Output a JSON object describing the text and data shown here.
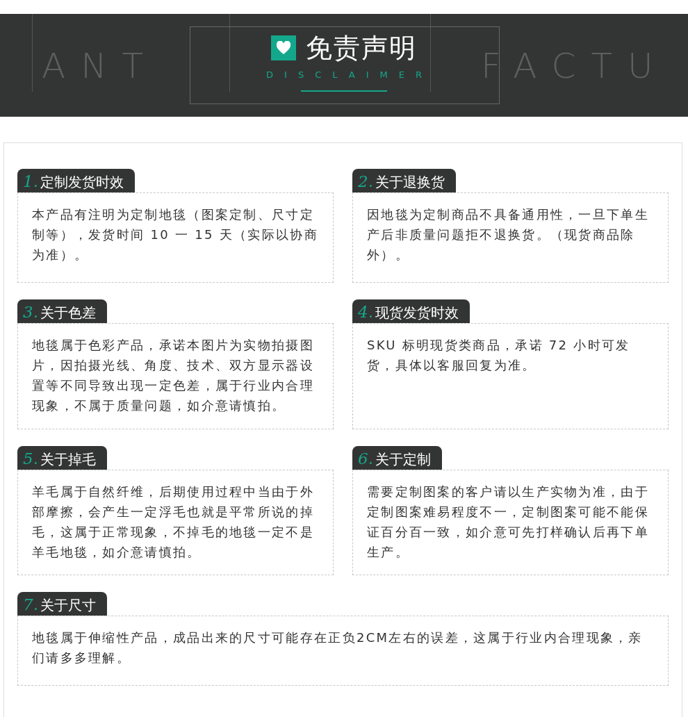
{
  "banner": {
    "title": "免责声明",
    "subtitle": "DISCLAIMER",
    "background_lettering_left": "ANT",
    "background_lettering_right": "FACTU"
  },
  "sections": [
    {
      "number": "1.",
      "title": "定制发货时效",
      "text": "本产品有注明为定制地毯（图案定制、尺寸定制等），发货时间 10 一 15 天（实际以协商为准）。",
      "kind": "half"
    },
    {
      "number": "2.",
      "title": "关于退换货",
      "text": "因地毯为定制商品不具备通用性，一旦下单生产后非质量问题拒不退换货。（现货商品除外）。",
      "kind": "half"
    },
    {
      "number": "3.",
      "title": "关于色差",
      "text": "地毯属于色彩产品，承诺本图片为实物拍摄图片，因拍摄光线、角度、技术、双方显示器设置等不同导致出现一定色差，属于行业内合理现象，不属于质量问题，如介意请慎拍。",
      "kind": "half"
    },
    {
      "number": "4.",
      "title": "现货发货时效",
      "text": "SKU 标明现货类商品，承诺 72 小时可发货，具体以客服回复为准。",
      "kind": "half"
    },
    {
      "number": "5.",
      "title": "关于掉毛",
      "text": "羊毛属于自然纤维，后期使用过程中当由于外部摩擦，会产生一定浮毛也就是平常所说的掉毛，这属于正常现象，不掉毛的地毯一定不是羊毛地毯，如介意请慎拍。",
      "kind": "half"
    },
    {
      "number": "6.",
      "title": "关于定制",
      "text": "需要定制图案的客户请以生产实物为准，由于定制图案难易程度不一，定制图案可能不能保证百分百一致，如介意可先打样确认后再下单生产。",
      "kind": "half"
    },
    {
      "number": "7.",
      "title": "关于尺寸",
      "text": "地毯属于伸缩性产品，成品出来的尺寸可能存在正负2CM左右的误差，这属于行业内合理现象，亲们请多多理解。",
      "kind": "wide"
    }
  ]
}
